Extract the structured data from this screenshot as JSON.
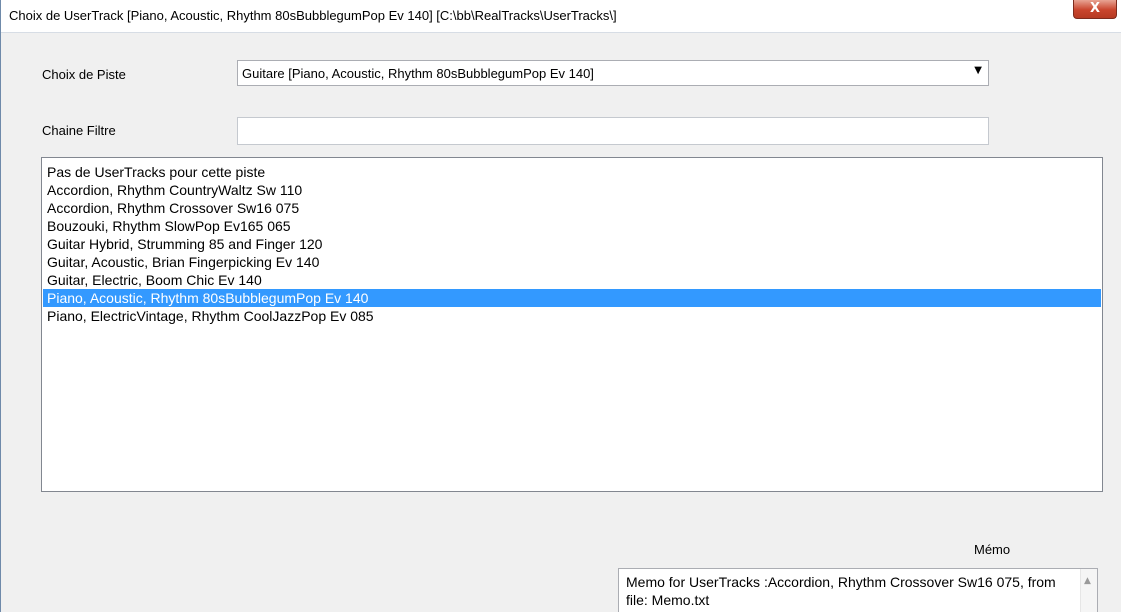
{
  "window": {
    "title": "Choix de UserTrack   [Piano, Acoustic, Rhythm 80sBubblegumPop Ev 140]   [C:\\bb\\RealTracks\\UserTracks\\]",
    "close_label": "X"
  },
  "track_choice": {
    "label": "Choix de Piste",
    "selected": "Guitare   [Piano, Acoustic, Rhythm 80sBubblegumPop Ev 140]",
    "icon": "dropdown-arrow-icon"
  },
  "filter": {
    "label": "Chaine Filtre",
    "value": ""
  },
  "usertracks": {
    "items": [
      "Pas de UserTracks pour cette piste",
      "Accordion, Rhythm CountryWaltz Sw 110",
      "Accordion, Rhythm Crossover Sw16 075",
      "Bouzouki, Rhythm SlowPop Ev165 065",
      "Guitar Hybrid, Strumming 85 and Finger 120",
      "Guitar, Acoustic, Brian Fingerpicking Ev 140",
      "Guitar, Electric, Boom Chic Ev 140",
      "Piano, Acoustic, Rhythm 80sBubblegumPop Ev 140",
      "Piano, ElectricVintage, Rhythm CoolJazzPop Ev 085"
    ],
    "selected_index": 7,
    "selection_color": "#3399ff"
  },
  "memo": {
    "label": "Mémo",
    "text": "Memo for UserTracks :Accordion, Rhythm Crossover Sw16 075, from file: Memo.txt",
    "scroll_icon": "scroll-up-arrow-icon"
  }
}
